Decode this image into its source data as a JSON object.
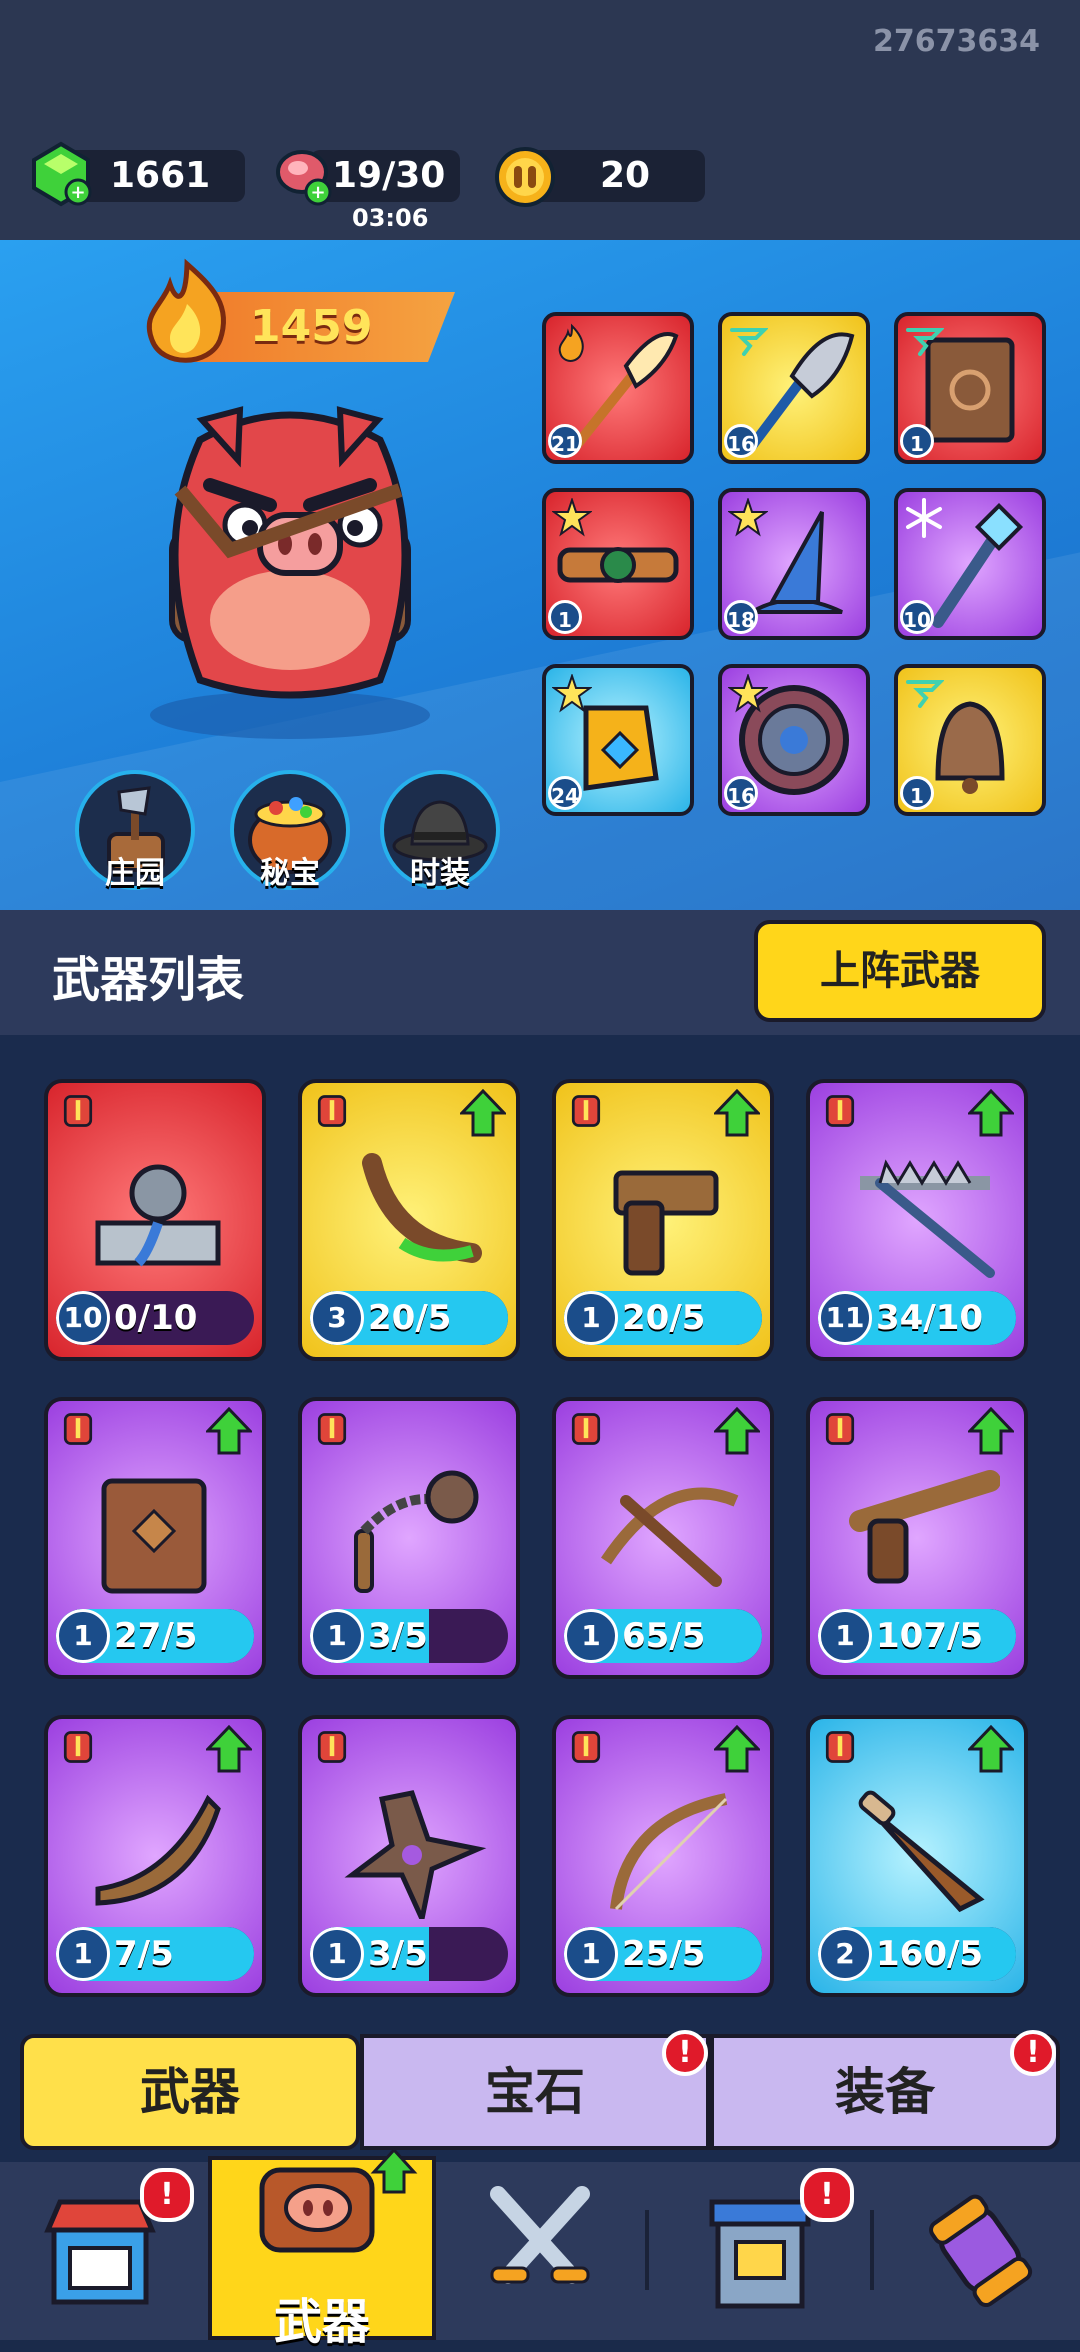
{
  "top": {
    "user_id": "27673634",
    "gems": "1661",
    "stamina": "19/30",
    "stamina_timer": "03:06",
    "coins": "20"
  },
  "hero": {
    "power": "1459",
    "slots": [
      {
        "level": "21",
        "color": "red",
        "icon": "flame-icon",
        "item": "golden-feather-scepter"
      },
      {
        "level": "16",
        "color": "yellow",
        "icon": "whirlwind-icon",
        "item": "feather-staff"
      },
      {
        "level": "1",
        "color": "red",
        "icon": "whirlwind-icon",
        "item": "spell-book"
      },
      {
        "level": "1",
        "color": "red",
        "icon": "burst-icon",
        "item": "leather-belt"
      },
      {
        "level": "18",
        "color": "purple",
        "icon": "burst-icon",
        "item": "wizard-hat"
      },
      {
        "level": "10",
        "color": "purple",
        "icon": "snowflake-icon",
        "item": "ice-staff"
      },
      {
        "level": "24",
        "color": "cyan",
        "icon": "burst-icon",
        "item": "gem-glove"
      },
      {
        "level": "16",
        "color": "purple",
        "icon": "burst-icon",
        "item": "round-shield"
      },
      {
        "level": "1",
        "color": "yellow",
        "icon": "whirlwind-icon",
        "item": "bell"
      }
    ],
    "buttons": [
      {
        "label": "庄园",
        "icon": "axe-stump-icon"
      },
      {
        "label": "秘宝",
        "icon": "treasure-pot-icon"
      },
      {
        "label": "时装",
        "icon": "fedora-hat-icon"
      }
    ]
  },
  "list": {
    "title": "武器列表",
    "deploy_label": "上阵武器"
  },
  "weapons": [
    {
      "level": "10",
      "count": "0/10",
      "progress": 0.0,
      "color": "red",
      "item": "anvil-fountain"
    },
    {
      "level": "3",
      "count": "20/5",
      "progress": 1.0,
      "color": "yellow",
      "item": "slime-horn"
    },
    {
      "level": "1",
      "count": "20/5",
      "progress": 1.0,
      "color": "yellow",
      "item": "wooden-pistol"
    },
    {
      "level": "11",
      "count": "34/10",
      "progress": 1.0,
      "color": "purple",
      "item": "spiked-rake"
    },
    {
      "level": "1",
      "count": "27/5",
      "progress": 1.0,
      "color": "purple",
      "item": "leather-tome"
    },
    {
      "level": "1",
      "count": "3/5",
      "progress": 0.6,
      "color": "purple",
      "item": "morning-star-flail"
    },
    {
      "level": "1",
      "count": "65/5",
      "progress": 1.0,
      "color": "purple",
      "item": "crossbow"
    },
    {
      "level": "1",
      "count": "107/5",
      "progress": 1.0,
      "color": "purple",
      "item": "flintlock-pistol"
    },
    {
      "level": "1",
      "count": "7/5",
      "progress": 1.0,
      "color": "purple",
      "item": "boomerang"
    },
    {
      "level": "1",
      "count": "3/5",
      "progress": 0.6,
      "color": "purple",
      "item": "shuriken"
    },
    {
      "level": "1",
      "count": "25/5",
      "progress": 1.0,
      "color": "purple",
      "item": "longbow"
    },
    {
      "level": "2",
      "count": "160/5",
      "progress": 1.0,
      "color": "cyan",
      "item": "dagger"
    }
  ],
  "tabs": [
    {
      "label": "武器",
      "active": true
    },
    {
      "label": "宝石",
      "active": false
    },
    {
      "label": "装备",
      "active": false
    }
  ],
  "nav": {
    "weapons_label": "武器",
    "alert_symbol": "!"
  },
  "colors": {
    "red": "#d8242c",
    "yellow": "#f0c21a",
    "purple": "#9b3fe0",
    "cyan": "#2ab4e8",
    "accent_yellow": "#ffd61a",
    "progress_cyan": "#25c8f0"
  }
}
